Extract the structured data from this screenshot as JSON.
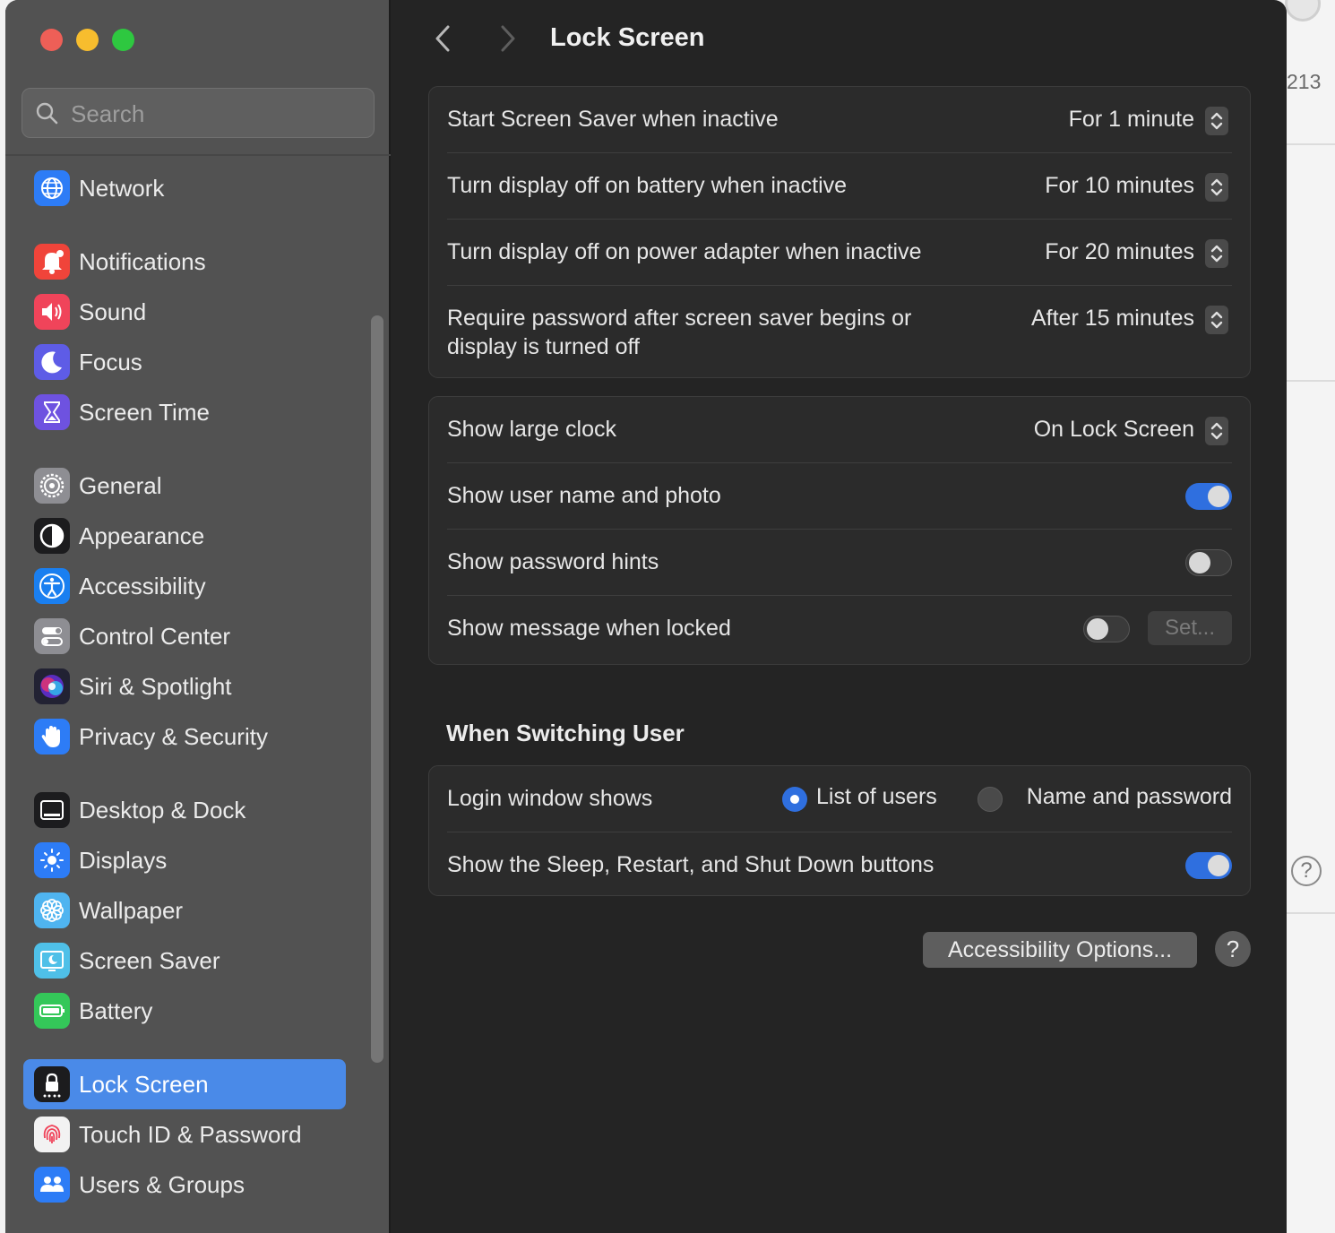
{
  "background": {
    "number": "213"
  },
  "window": {
    "title": "Lock Screen",
    "search": {
      "placeholder": "Search"
    },
    "sidebar": {
      "items": [
        {
          "label": "Network",
          "icon": "globe-icon",
          "color": "#2d7cf6"
        },
        {
          "label": "Notifications",
          "icon": "bell-icon",
          "color": "#f0443a"
        },
        {
          "label": "Sound",
          "icon": "speaker-icon",
          "color": "#f0445a"
        },
        {
          "label": "Focus",
          "icon": "moon-icon",
          "color": "#5e5ce6"
        },
        {
          "label": "Screen Time",
          "icon": "hourglass-icon",
          "color": "#6e52e0"
        },
        {
          "label": "General",
          "icon": "gear-icon",
          "color": "#8e8e93"
        },
        {
          "label": "Appearance",
          "icon": "appearance-icon",
          "color": "#1c1c1e"
        },
        {
          "label": "Accessibility",
          "icon": "accessibility-icon",
          "color": "#1a7ff0"
        },
        {
          "label": "Control Center",
          "icon": "switches-icon",
          "color": "#8e8e93"
        },
        {
          "label": "Siri & Spotlight",
          "icon": "siri-icon",
          "color": "#222233"
        },
        {
          "label": "Privacy & Security",
          "icon": "hand-icon",
          "color": "#2d7cf6"
        },
        {
          "label": "Desktop & Dock",
          "icon": "dock-icon",
          "color": "#1c1c1e"
        },
        {
          "label": "Displays",
          "icon": "sun-icon",
          "color": "#2d7cf6"
        },
        {
          "label": "Wallpaper",
          "icon": "flower-icon",
          "color": "#4fb4f0"
        },
        {
          "label": "Screen Saver",
          "icon": "screensaver-icon",
          "color": "#4fc0e8"
        },
        {
          "label": "Battery",
          "icon": "battery-icon",
          "color": "#34c759"
        },
        {
          "label": "Lock Screen",
          "icon": "lock-icon",
          "color": "#1c1c1e",
          "selected": true
        },
        {
          "label": "Touch ID & Password",
          "icon": "fingerprint-icon",
          "color": "#f2f2f2"
        },
        {
          "label": "Users & Groups",
          "icon": "users-icon",
          "color": "#2d7cf6"
        }
      ]
    },
    "group1": {
      "rows": [
        {
          "label": "Start Screen Saver when inactive",
          "value": "For 1 minute"
        },
        {
          "label": "Turn display off on battery when inactive",
          "value": "For 10 minutes"
        },
        {
          "label": "Turn display off on power adapter when inactive",
          "value": "For 20 minutes"
        },
        {
          "label": "Require password after screen saver begins or display is turned off",
          "value": "After 15 minutes"
        }
      ]
    },
    "group2": {
      "clock": {
        "label": "Show large clock",
        "value": "On Lock Screen"
      },
      "user_name_photo": {
        "label": "Show user name and photo",
        "on": true
      },
      "password_hints": {
        "label": "Show password hints",
        "on": false
      },
      "message": {
        "label": "Show message when locked",
        "on": false,
        "button": "Set..."
      }
    },
    "switching": {
      "heading": "When Switching User",
      "login": {
        "label": "Login window shows",
        "option1": "List of users",
        "option2": "Name and password",
        "selected": "List of users"
      },
      "sleep_buttons": {
        "label": "Show the Sleep, Restart, and Shut Down buttons",
        "on": true
      }
    },
    "footer": {
      "accessibility_button": "Accessibility Options...",
      "help": "?"
    }
  }
}
